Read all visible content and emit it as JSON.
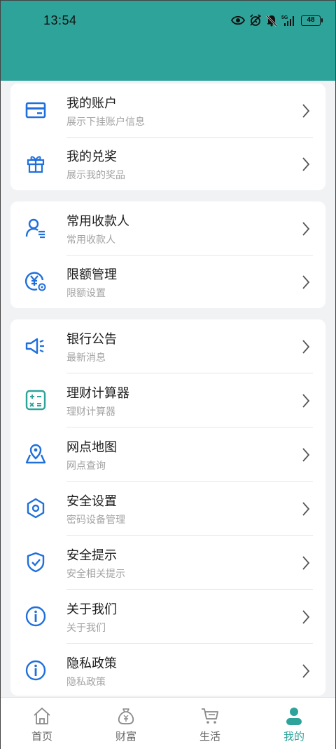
{
  "status_bar": {
    "time": "13:54",
    "battery": "48",
    "icons": [
      "eye-icon",
      "alarm-icon",
      "mute-bell-icon",
      "signal-5g-icon",
      "battery-icon"
    ]
  },
  "colors": {
    "header": "#2ea39a",
    "accent_blue": "#1f6fdc",
    "accent_teal": "#2ea39a"
  },
  "cards": [
    {
      "items": [
        {
          "title": "我的账户",
          "subtitle": "展示下挂账户信息",
          "icon": "card-icon"
        },
        {
          "title": "我的兑奖",
          "subtitle": "展示我的奖品",
          "icon": "gift-icon"
        }
      ]
    },
    {
      "items": [
        {
          "title": "常用收款人",
          "subtitle": "常用收款人",
          "icon": "payee-icon"
        },
        {
          "title": "限额管理",
          "subtitle": "限额设置",
          "icon": "limit-yen-icon"
        }
      ]
    },
    {
      "items": [
        {
          "title": "银行公告",
          "subtitle": "最新消息",
          "icon": "megaphone-icon"
        },
        {
          "title": "理财计算器",
          "subtitle": "理财计算器",
          "icon": "calculator-icon"
        },
        {
          "title": "网点地图",
          "subtitle": "网点查询",
          "icon": "map-pin-icon"
        },
        {
          "title": "安全设置",
          "subtitle": "密码设备管理",
          "icon": "hexagon-settings-icon"
        },
        {
          "title": "安全提示",
          "subtitle": "安全相关提示",
          "icon": "shield-check-icon"
        },
        {
          "title": "关于我们",
          "subtitle": "关于我们",
          "icon": "info-icon"
        },
        {
          "title": "隐私政策",
          "subtitle": "隐私政策",
          "icon": "info-icon"
        }
      ]
    }
  ],
  "tabbar": {
    "tabs": [
      {
        "label": "首页",
        "icon": "home-icon"
      },
      {
        "label": "财富",
        "icon": "money-bag-icon"
      },
      {
        "label": "生活",
        "icon": "cart-icon"
      },
      {
        "label": "我的",
        "icon": "user-icon",
        "active": true
      }
    ]
  }
}
